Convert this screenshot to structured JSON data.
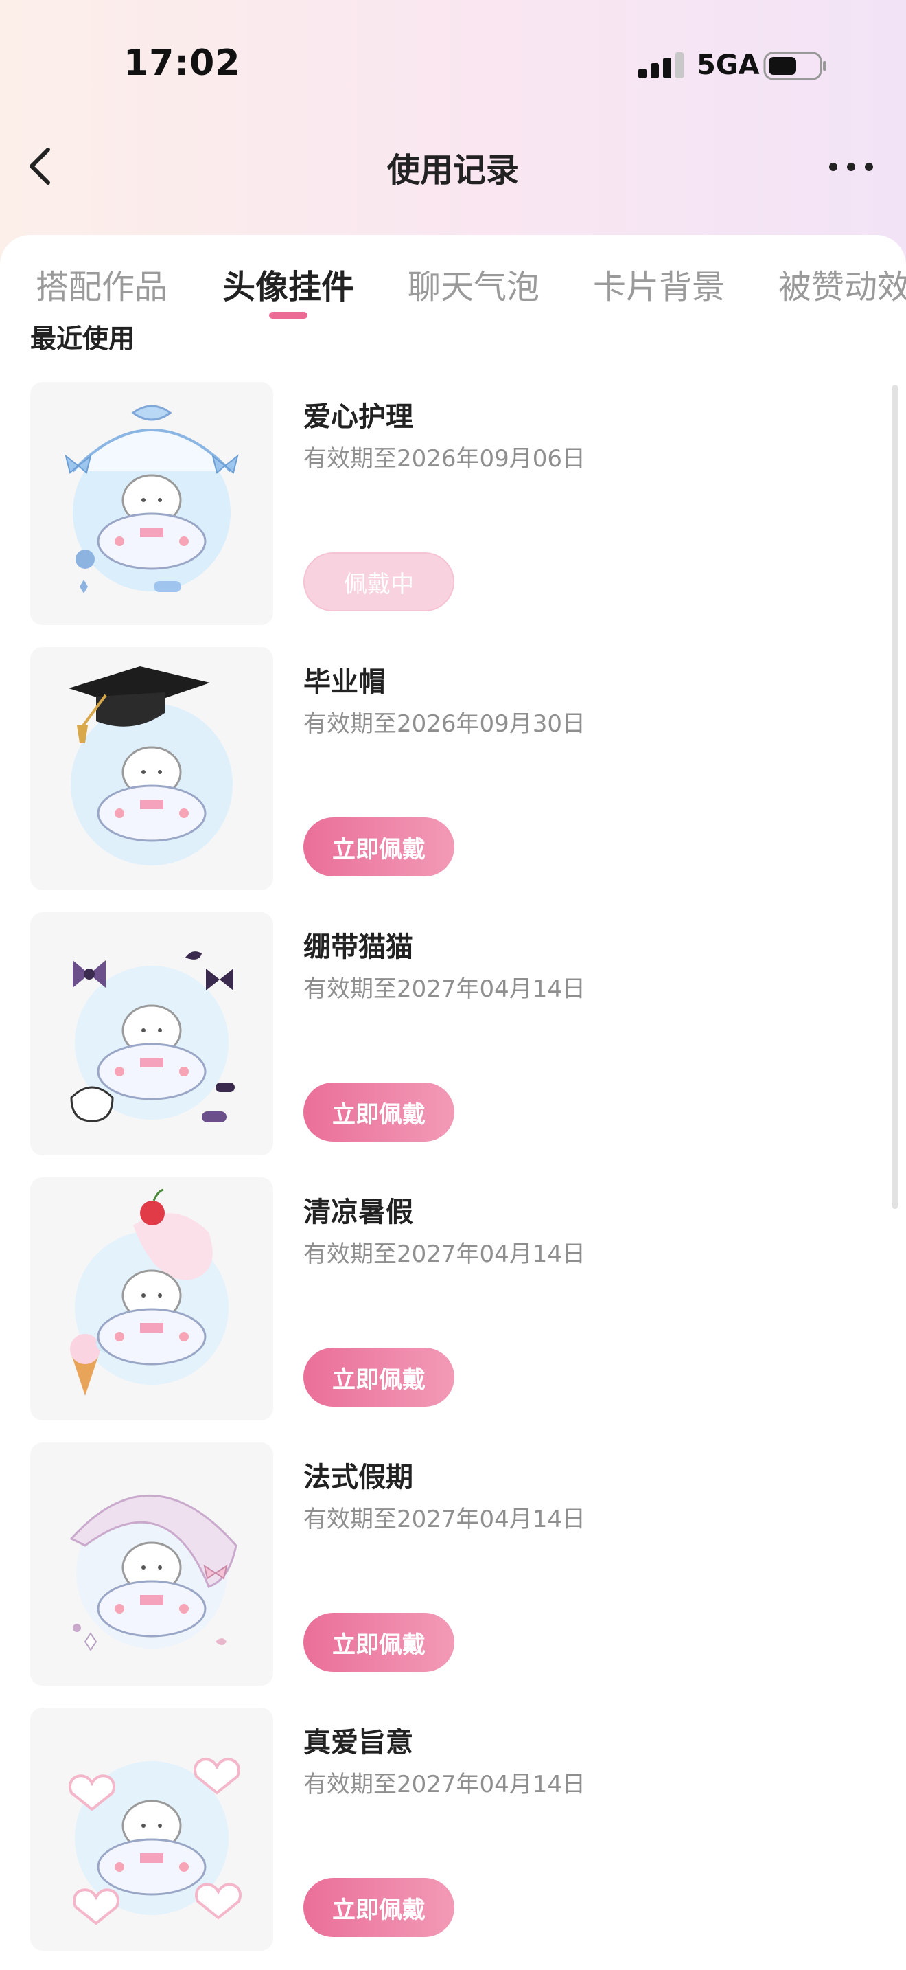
{
  "status_bar": {
    "time": "17:02",
    "network": "5GA",
    "signal_icon": "signal-bars-icon",
    "battery_icon": "battery-icon"
  },
  "nav": {
    "title": "使用记录",
    "back_icon": "chevron-left-icon",
    "more_icon": "more-dots-icon"
  },
  "tabs": [
    {
      "label": "搭配作品",
      "active": false
    },
    {
      "label": "头像挂件",
      "active": true
    },
    {
      "label": "聊天气泡",
      "active": false
    },
    {
      "label": "卡片背景",
      "active": false
    },
    {
      "label": "被赞动效",
      "active": false
    }
  ],
  "section_title": "最近使用",
  "items": [
    {
      "name": "爱心护理",
      "validity": "有效期至2026年09月06日",
      "button": "佩戴中",
      "wearing": true,
      "frame_icon": "nurse-cap-frame-icon"
    },
    {
      "name": "毕业帽",
      "validity": "有效期至2026年09月30日",
      "button": "立即佩戴",
      "wearing": false,
      "frame_icon": "graduation-cap-frame-icon"
    },
    {
      "name": "绷带猫猫",
      "validity": "有效期至2027年04月14日",
      "button": "立即佩戴",
      "wearing": false,
      "frame_icon": "bandage-cat-frame-icon"
    },
    {
      "name": "清凉暑假",
      "validity": "有效期至2027年04月14日",
      "button": "立即佩戴",
      "wearing": false,
      "frame_icon": "summer-icecream-frame-icon"
    },
    {
      "name": "法式假期",
      "validity": "有效期至2027年04月14日",
      "button": "立即佩戴",
      "wearing": false,
      "frame_icon": "french-lace-frame-icon"
    },
    {
      "name": "真爱旨意",
      "validity": "有效期至2027年04月14日",
      "button": "立即佩戴",
      "wearing": false,
      "frame_icon": "hearts-frame-icon"
    }
  ],
  "colors": {
    "accent": "#ec6b95",
    "button_gradient_start": "#ea6f99",
    "button_gradient_end": "#f29ab6",
    "wearing_button": "#f8d3df"
  }
}
